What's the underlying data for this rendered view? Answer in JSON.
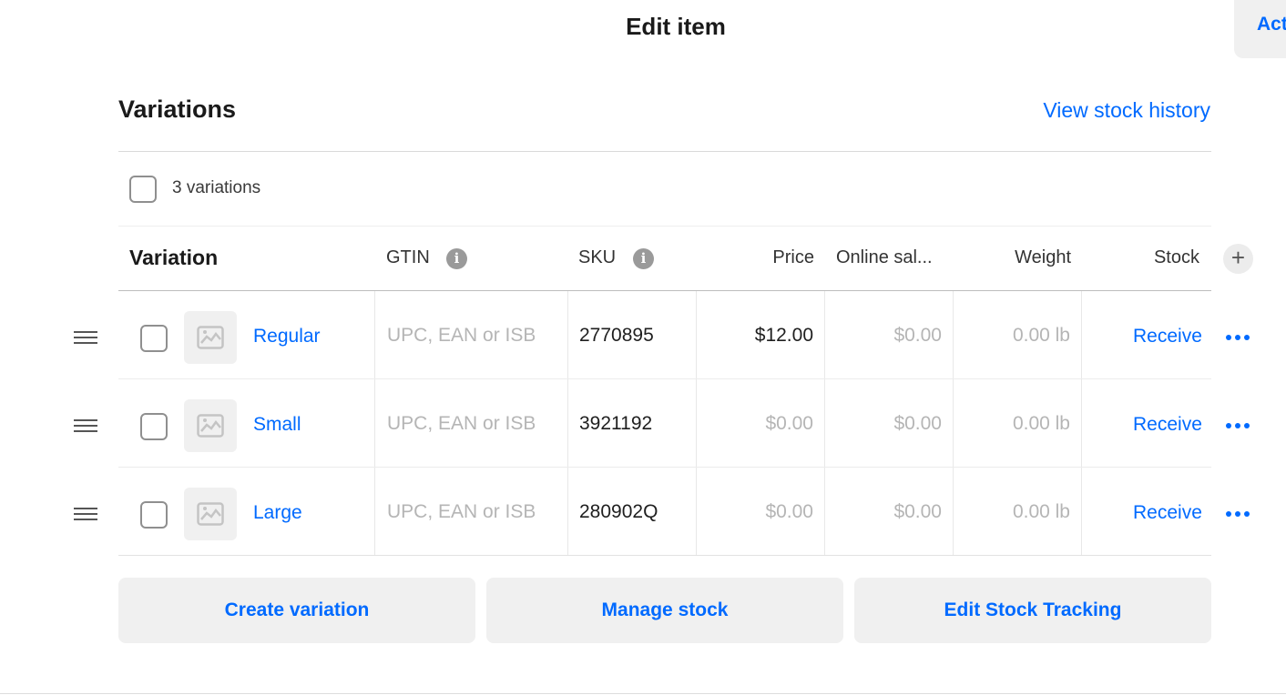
{
  "header": {
    "title": "Edit item",
    "action_label": "Act"
  },
  "section": {
    "title": "Variations",
    "stock_history_link": "View stock history",
    "count_label": "3 variations"
  },
  "table": {
    "columns": {
      "variation": "Variation",
      "gtin": "GTIN",
      "sku": "SKU",
      "price": "Price",
      "online_sale": "Online sal...",
      "weight": "Weight",
      "stock": "Stock"
    },
    "rows": [
      {
        "name": "Regular",
        "gtin_placeholder": "UPC, EAN or ISBN",
        "sku": "2770895",
        "price": "$12.00",
        "online_price": "$0.00",
        "weight": "0.00 lb",
        "stock_action": "Receive"
      },
      {
        "name": "Small",
        "gtin_placeholder": "UPC, EAN or ISBN",
        "sku": "3921192",
        "price": "$0.00",
        "online_price": "$0.00",
        "weight": "0.00 lb",
        "stock_action": "Receive"
      },
      {
        "name": "Large",
        "gtin_placeholder": "UPC, EAN or ISBN",
        "sku": "280902Q",
        "price": "$0.00",
        "online_price": "$0.00",
        "weight": "0.00 lb",
        "stock_action": "Receive"
      }
    ]
  },
  "footer": {
    "create_variation": "Create variation",
    "manage_stock": "Manage stock",
    "edit_stock_tracking": "Edit Stock Tracking"
  },
  "icons": {
    "drag": "drag-handle-icon",
    "image": "image-placeholder-icon",
    "info": "info-icon",
    "more": "more-options-icon",
    "add": "plus-icon"
  },
  "colors": {
    "accent": "#006aff",
    "placeholder": "#b5b5b5",
    "button_bg": "#f0f0f0"
  }
}
